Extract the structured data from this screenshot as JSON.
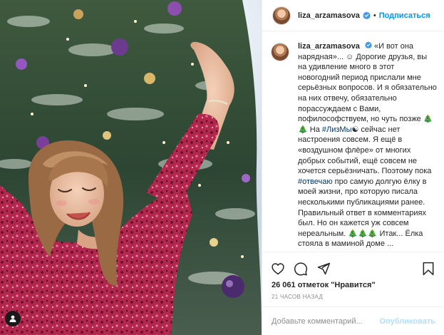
{
  "photo": {
    "alt_icon": "user-tag-icon"
  },
  "post": {
    "username": "liza_arzamasova",
    "separator": "•",
    "follow_label": "Подписаться",
    "caption": {
      "username": "liza_arzamasova",
      "p1": "«И вот она нарядная»... ☺ Дорогие друзья, вы на удивление много в этот новогодний период прислали мне серьёзных вопросов. И я обязательно на них отвечу, обязательно порассуждаем с Вами, пофилософствуем, но чуть позже 🎄🎄 На ",
      "hashtag1": "#ЛизМы",
      "p2": "☯ сейчас нет настроения совсем. Я ещё в «воздушном флёре» от многих добрых событий, ещё совсем не хочется серьёзничать. Поэтому пока ",
      "hashtag2": "#отвечаю",
      "p3": " про самую долгую ёлку в моей жизни, про которую писала несколькими публикациями ранее. Правильный ответ в комментариях был. Но он кажется уж совсем нереальным. 🎄🎄🎄 Итак... Ёлка стояла в маминой доме ..."
    },
    "likes": "26 061 отметок \"Нравится\"",
    "time": "21 ЧАСОВ НАЗАД",
    "comment_placeholder": "Добавьте комментарий...",
    "publish_label": "Опубликовать"
  },
  "colors": {
    "accent": "#0095f6",
    "publish_disabled": "#b2dffc",
    "verified": "#3897f0",
    "hashtag": "#00376b"
  }
}
